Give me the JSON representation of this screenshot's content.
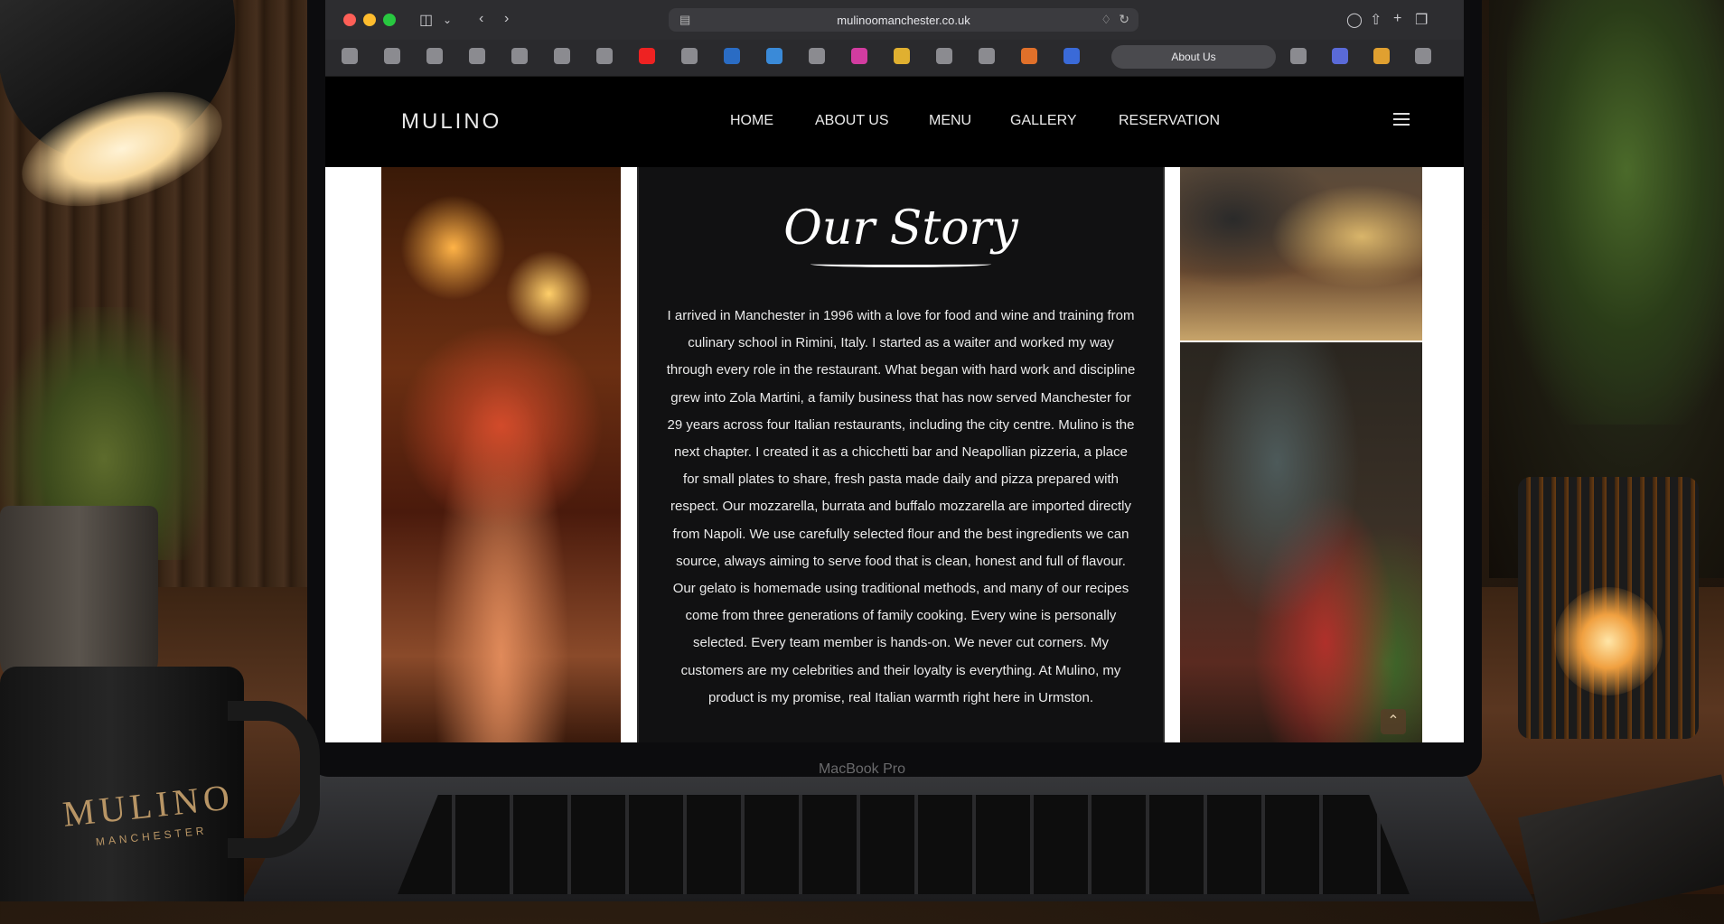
{
  "browser": {
    "url": "mulinoomanchester.co.uk",
    "active_tab_label": "About Us"
  },
  "site": {
    "logo": "MULINO",
    "nav": [
      "HOME",
      "ABOUT US",
      "MENU",
      "GALLERY",
      "RESERVATION"
    ]
  },
  "story": {
    "title": "Our Story",
    "text": "I arrived in Manchester in 1996 with a love for food and wine and training from culinary school in Rimini, Italy. I started as a waiter and worked my way through every role in the restaurant. What began with hard work and discipline grew into Zola Martini, a family business that has now served Manchester for 29 years across four Italian restaurants, including the city centre. Mulino is the next chapter. I created it as a chicchetti bar and Neapollian pizzeria, a place for small plates to share, fresh pasta made daily and pizza prepared with respect. Our mozzarella, burrata and buffalo mozzarella are imported directly from Napoli. We use carefully selected flour and the best ingredients we can source, always aiming to serve food that is clean, honest and full of flavour. Our gelato is homemade using traditional methods, and many of our recipes come from three generations of family cooking. Every wine is personally selected. Every team member is hands-on. We never cut corners. My customers are my celebrities and their loyalty is everything. At Mulino, my product is my promise, real Italian warmth right here in Urmston."
  },
  "device": {
    "laptop_label": "MacBook Pro",
    "mug_brand": "MULINO",
    "mug_city": "MANCHESTER"
  },
  "icons": {
    "scroll_top": "chevron-up-icon",
    "menu": "hamburger-menu-icon"
  }
}
